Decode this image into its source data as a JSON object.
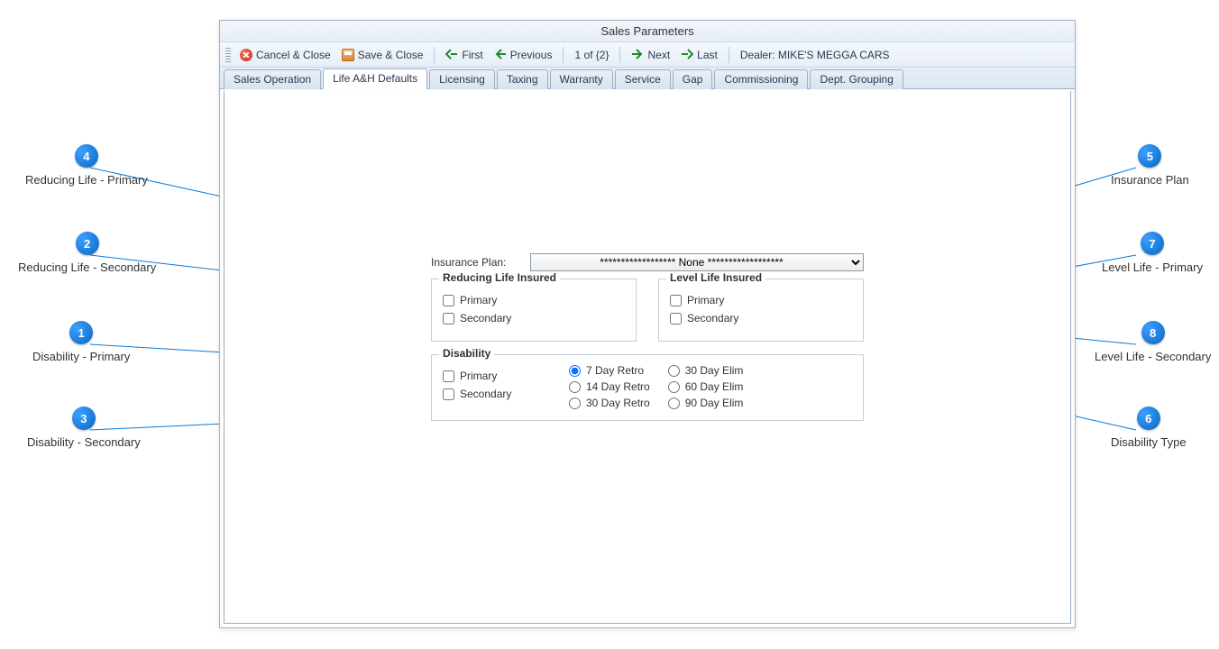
{
  "window": {
    "title": "Sales Parameters"
  },
  "toolbar": {
    "cancel": "Cancel & Close",
    "save": "Save & Close",
    "first": "First",
    "previous": "Previous",
    "position": "1 of {2}",
    "next": "Next",
    "last": "Last",
    "dealer_label": "Dealer:",
    "dealer_value": "MIKE'S MEGGA CARS"
  },
  "tabs": [
    {
      "label": "Sales Operation"
    },
    {
      "label": "Life A&H Defaults"
    },
    {
      "label": "Licensing"
    },
    {
      "label": "Taxing"
    },
    {
      "label": "Warranty"
    },
    {
      "label": "Service"
    },
    {
      "label": "Gap"
    },
    {
      "label": "Commissioning"
    },
    {
      "label": "Dept. Grouping"
    }
  ],
  "active_tab_index": 1,
  "form": {
    "insurance_plan_label": "Insurance Plan:",
    "insurance_plan_value": "****************** None ******************",
    "reducing_legend": "Reducing Life Insured",
    "level_legend": "Level Life Insured",
    "disability_legend": "Disability",
    "primary_label": "Primary",
    "secondary_label": "Secondary",
    "radios": {
      "r7": "7 Day Retro",
      "r14": "14 Day Retro",
      "r30": "30 Day Retro",
      "e30": "30 Day Elim",
      "e60": "60 Day Elim",
      "e90": "90 Day Elim"
    }
  },
  "callouts": {
    "c1": {
      "num": "1",
      "label": "Disability - Primary"
    },
    "c2": {
      "num": "2",
      "label": "Reducing Life - Secondary"
    },
    "c3": {
      "num": "3",
      "label": "Disability - Secondary"
    },
    "c4": {
      "num": "4",
      "label": "Reducing Life - Primary"
    },
    "c5": {
      "num": "5",
      "label": "Insurance Plan"
    },
    "c6": {
      "num": "6",
      "label": "Disability Type"
    },
    "c7": {
      "num": "7",
      "label": "Level Life - Primary"
    },
    "c8": {
      "num": "8",
      "label": "Level Life - Secondary"
    }
  },
  "colors": {
    "accent": "#0a66c2",
    "border": "#9db0c4"
  }
}
